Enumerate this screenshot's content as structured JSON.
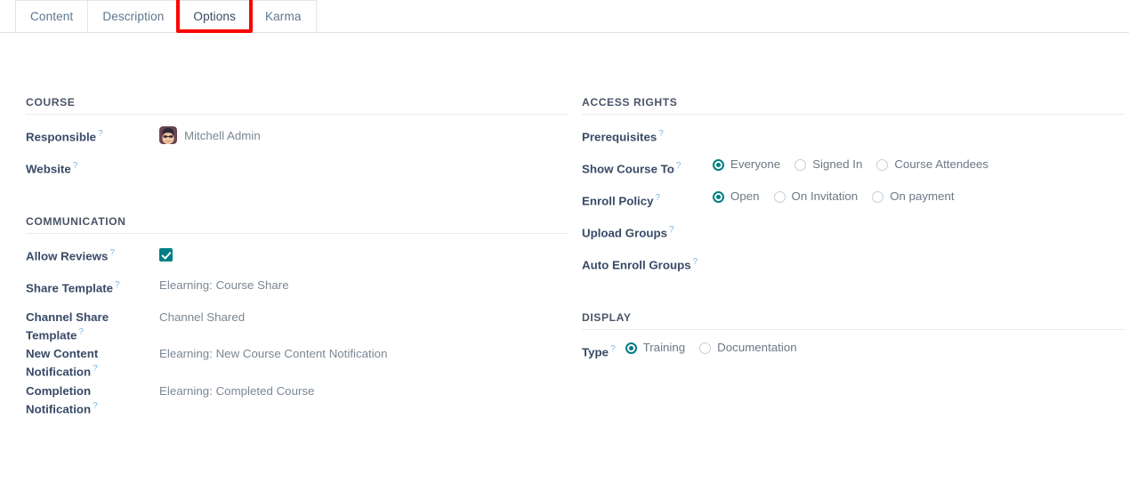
{
  "tabs": [
    {
      "label": "Content",
      "active": false
    },
    {
      "label": "Description",
      "active": false
    },
    {
      "label": "Options",
      "active": true
    },
    {
      "label": "Karma",
      "active": false
    }
  ],
  "highlight": {
    "target_tab": "Options",
    "color": "#fe0000"
  },
  "theme": {
    "accent": "#017e84",
    "label_color": "#374a66",
    "value_color": "#7b8794",
    "help_marker": "?"
  },
  "groups": {
    "course": {
      "title": "COURSE",
      "fields": [
        {
          "label": "Responsible",
          "help": "?",
          "value": "Mitchell Admin",
          "avatar": "user-avatar"
        },
        {
          "label": "Website",
          "help": "?",
          "value": ""
        }
      ]
    },
    "communication": {
      "title": "COMMUNICATION",
      "fields": [
        {
          "label": "Allow Reviews",
          "help": "?",
          "checked": true
        },
        {
          "label": "Share Template",
          "help": "?",
          "value": "Elearning: Course Share"
        },
        {
          "label": "Channel Share Template",
          "help": "?",
          "value": "Channel Shared"
        },
        {
          "label": "New Content Notification",
          "help": "?",
          "value": "Elearning: New Course Content Notification"
        },
        {
          "label": "Completion Notification",
          "help": "?",
          "value": "Elearning: Completed Course"
        }
      ]
    },
    "access_rights": {
      "title": "ACCESS RIGHTS",
      "fields": [
        {
          "label": "Prerequisites",
          "help": "?",
          "value": ""
        },
        {
          "label": "Show Course To",
          "help": "?",
          "options": [
            {
              "label": "Everyone",
              "selected": true
            },
            {
              "label": "Signed In",
              "selected": false
            },
            {
              "label": "Course Attendees",
              "selected": false
            }
          ]
        },
        {
          "label": "Enroll Policy",
          "help": "?",
          "options": [
            {
              "label": "Open",
              "selected": true
            },
            {
              "label": "On Invitation",
              "selected": false
            },
            {
              "label": "On payment",
              "selected": false
            }
          ]
        },
        {
          "label": "Upload Groups",
          "help": "?",
          "value": ""
        },
        {
          "label": "Auto Enroll Groups",
          "help": "?",
          "value": ""
        }
      ]
    },
    "display": {
      "title": "DISPLAY",
      "fields": [
        {
          "label": "Type",
          "help": "?",
          "options": [
            {
              "label": "Training",
              "selected": true
            },
            {
              "label": "Documentation",
              "selected": false
            }
          ]
        }
      ]
    }
  }
}
